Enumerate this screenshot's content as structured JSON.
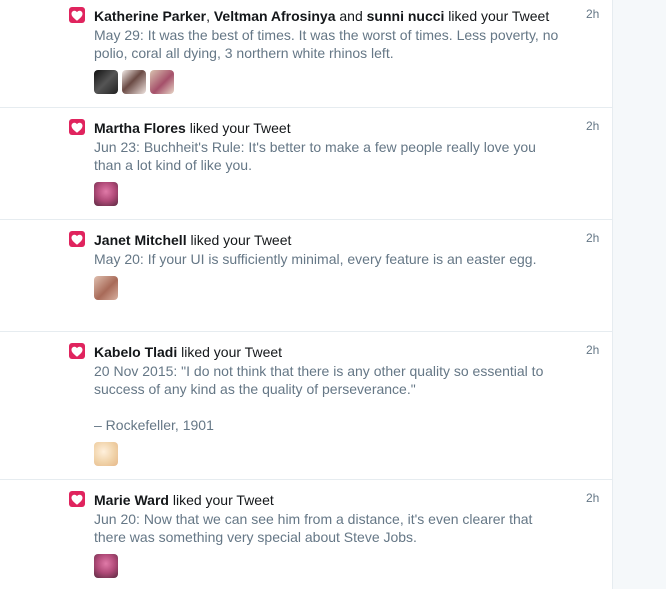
{
  "notifications": [
    {
      "names": [
        "Katherine Parker",
        "Veltman Afrosinya",
        "sunni nucci"
      ],
      "sep1": ", ",
      "sep2": " and ",
      "action": " liked your Tweet",
      "tweet": "May 29: It was the best of times. It was the worst of times. Less poverty, no polio, coral all dying, 3 northern white rhinos left.",
      "time": "2h",
      "avatars": [
        "#3a3a3a",
        "#d8c6c2",
        "#c9a79a"
      ]
    },
    {
      "names": [
        "Martha Flores"
      ],
      "action": " liked your Tweet",
      "tweet": "Jun 23: Buchheit's Rule: It's better to make a few people really love you than a lot kind of like you.",
      "time": "2h",
      "avatars": [
        "#b04a78"
      ]
    },
    {
      "names": [
        "Janet Mitchell"
      ],
      "action": " liked your Tweet",
      "tweet": "May 20: If your UI is sufficiently minimal, every feature is an easter egg.",
      "time": "2h",
      "avatars": [
        "#b88a78"
      ]
    },
    {
      "names": [
        "Kabelo Tladi"
      ],
      "action": " liked your Tweet",
      "tweet": "20 Nov 2015: \"I do not think that there is any other quality so essential to success of any kind as the quality of perseverance.\"\n\n– Rockefeller, 1901",
      "time": "2h",
      "avatars": [
        "#f0d2a8"
      ]
    },
    {
      "names": [
        "Marie Ward"
      ],
      "action": " liked your Tweet",
      "tweet": "Jun 20: Now that we can see him from a distance, it's even clearer that there was something very special about Steve Jobs.",
      "time": "2h",
      "avatars": [
        "#b04a78"
      ]
    }
  ],
  "colors": {
    "heart": "#e0245e",
    "muted_text": "#657786",
    "primary_text": "#14171a",
    "divider": "#e6ecf0"
  },
  "icons": {
    "like": "heart-icon"
  }
}
